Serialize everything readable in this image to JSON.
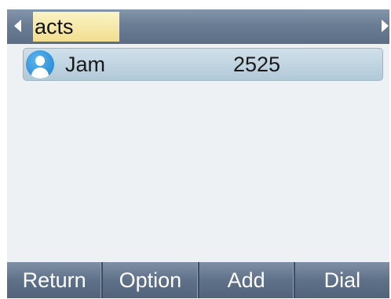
{
  "header": {
    "title": "acts",
    "left_arrow_icon": "triangle-left-icon",
    "right_arrow_icon": "triangle-right-icon"
  },
  "contacts": [
    {
      "name": "Jam",
      "number": "2525",
      "avatar_icon": "person-avatar-icon"
    }
  ],
  "softkeys": {
    "return_label": "Return",
    "option_label": "Option",
    "add_label": "Add",
    "dial_label": "Dial"
  },
  "colors": {
    "titlebar": "#6a7d94",
    "title_highlight": "#f1de8f",
    "selected_row": "#c0d4e1",
    "softkey_bar": "#5f7189",
    "background": "#eef1f3",
    "avatar": "#2f8fd8"
  }
}
